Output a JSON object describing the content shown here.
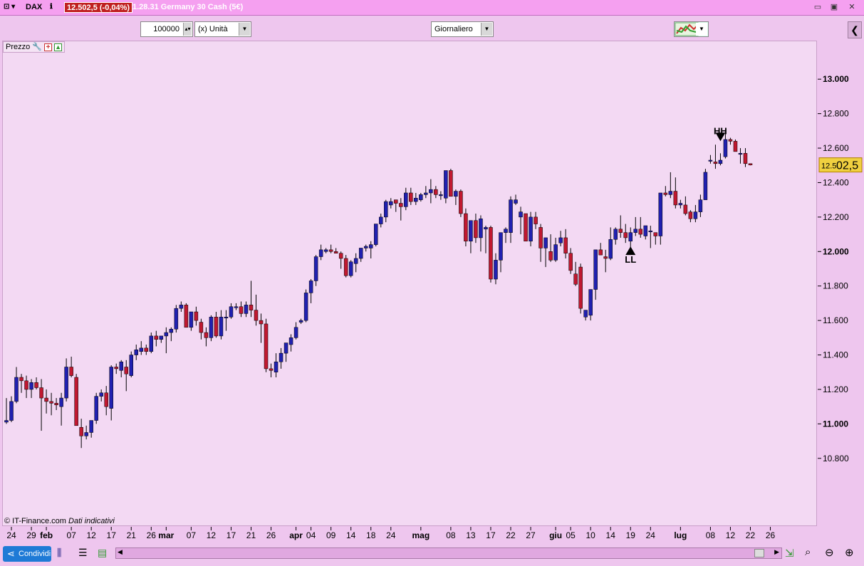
{
  "titlebar": {
    "symbol": "DAX",
    "price_badge": "12.502,5 (-0,04%)",
    "instrument": "1.28.31 Germany 30 Cash (5€)"
  },
  "toolbar": {
    "quantity": "100000",
    "unit": "(x) Unità",
    "timeframe": "Giornaliero"
  },
  "panel_label": "Prezzo",
  "footer": {
    "copyright": "© IT-Finance.com",
    "disclaimer": "Dati indicativi",
    "share_label": "Condividi"
  },
  "current_price_label": {
    "small": "12.5",
    "large": "02,5",
    "value": 12502.5
  },
  "colors": {
    "bull": "#2020b0",
    "bear": "#c01830",
    "background": "#f3d9f3",
    "current_price_bg": "#f0d040"
  },
  "chart_data": {
    "type": "candlestick",
    "title": "",
    "ylim": [
      10700,
      13100
    ],
    "y_ticks": [
      {
        "value": 13000,
        "label": "13.000",
        "bold": true
      },
      {
        "value": 12800,
        "label": "12.800",
        "bold": false
      },
      {
        "value": 12600,
        "label": "12.600",
        "bold": false
      },
      {
        "value": 12400,
        "label": "12.400",
        "bold": false
      },
      {
        "value": 12200,
        "label": "12.200",
        "bold": false
      },
      {
        "value": 12000,
        "label": "12.000",
        "bold": true
      },
      {
        "value": 11800,
        "label": "11.800",
        "bold": false
      },
      {
        "value": 11600,
        "label": "11.600",
        "bold": false
      },
      {
        "value": 11400,
        "label": "11.400",
        "bold": false
      },
      {
        "value": 11200,
        "label": "11.200",
        "bold": false
      },
      {
        "value": 11000,
        "label": "11.000",
        "bold": true
      },
      {
        "value": 10800,
        "label": "10.800",
        "bold": false
      }
    ],
    "x_ticks": [
      {
        "index": 1,
        "label": "24",
        "bold": false
      },
      {
        "index": 5,
        "label": "29",
        "bold": false
      },
      {
        "index": 8,
        "label": "feb",
        "bold": true
      },
      {
        "index": 13,
        "label": "07",
        "bold": false
      },
      {
        "index": 17,
        "label": "12",
        "bold": false
      },
      {
        "index": 21,
        "label": "17",
        "bold": false
      },
      {
        "index": 25,
        "label": "21",
        "bold": false
      },
      {
        "index": 29,
        "label": "26",
        "bold": false
      },
      {
        "index": 32,
        "label": "mar",
        "bold": true
      },
      {
        "index": 37,
        "label": "07",
        "bold": false
      },
      {
        "index": 41,
        "label": "12",
        "bold": false
      },
      {
        "index": 45,
        "label": "17",
        "bold": false
      },
      {
        "index": 49,
        "label": "21",
        "bold": false
      },
      {
        "index": 53,
        "label": "26",
        "bold": false
      },
      {
        "index": 58,
        "label": "apr",
        "bold": true
      },
      {
        "index": 61,
        "label": "04",
        "bold": false
      },
      {
        "index": 65,
        "label": "09",
        "bold": false
      },
      {
        "index": 69,
        "label": "14",
        "bold": false
      },
      {
        "index": 73,
        "label": "18",
        "bold": false
      },
      {
        "index": 77,
        "label": "24",
        "bold": false
      },
      {
        "index": 83,
        "label": "mag",
        "bold": true
      },
      {
        "index": 89,
        "label": "08",
        "bold": false
      },
      {
        "index": 93,
        "label": "13",
        "bold": false
      },
      {
        "index": 97,
        "label": "17",
        "bold": false
      },
      {
        "index": 101,
        "label": "22",
        "bold": false
      },
      {
        "index": 105,
        "label": "27",
        "bold": false
      },
      {
        "index": 110,
        "label": "giu",
        "bold": true
      },
      {
        "index": 113,
        "label": "05",
        "bold": false
      },
      {
        "index": 117,
        "label": "10",
        "bold": false
      },
      {
        "index": 121,
        "label": "14",
        "bold": false
      },
      {
        "index": 125,
        "label": "19",
        "bold": false
      },
      {
        "index": 129,
        "label": "24",
        "bold": false
      },
      {
        "index": 135,
        "label": "lug",
        "bold": true
      },
      {
        "index": 141,
        "label": "08",
        "bold": false
      },
      {
        "index": 145,
        "label": "12",
        "bold": false
      },
      {
        "index": 149,
        "label": "22",
        "bold": false
      },
      {
        "index": 153,
        "label": "26",
        "bold": false
      }
    ],
    "candles": [
      [
        11010,
        11150,
        11000,
        11020
      ],
      [
        11020,
        11160,
        11010,
        11130
      ],
      [
        11130,
        11330,
        11120,
        11270
      ],
      [
        11270,
        11290,
        11180,
        11250
      ],
      [
        11250,
        11280,
        11150,
        11200
      ],
      [
        11200,
        11260,
        11150,
        11240
      ],
      [
        11240,
        11270,
        11200,
        11210
      ],
      [
        11210,
        11260,
        10960,
        11150
      ],
      [
        11150,
        11200,
        11060,
        11130
      ],
      [
        11130,
        11180,
        11050,
        11120
      ],
      [
        11120,
        11150,
        11080,
        11110
      ],
      [
        11100,
        11180,
        10990,
        11150
      ],
      [
        11150,
        11380,
        11130,
        11330
      ],
      [
        11330,
        11390,
        11270,
        11280
      ],
      [
        11270,
        11290,
        11000,
        10990
      ],
      [
        10980,
        11030,
        10860,
        10930
      ],
      [
        10930,
        10990,
        10910,
        10950
      ],
      [
        10950,
        11020,
        10920,
        11020
      ],
      [
        11020,
        11180,
        11000,
        11160
      ],
      [
        11160,
        11200,
        11130,
        11180
      ],
      [
        11180,
        11220,
        11050,
        11100
      ],
      [
        11090,
        11340,
        11020,
        11330
      ],
      [
        11330,
        11350,
        11290,
        11320
      ],
      [
        11310,
        11370,
        11270,
        11360
      ],
      [
        11330,
        11370,
        11190,
        11290
      ],
      [
        11280,
        11420,
        11270,
        11400
      ],
      [
        11400,
        11460,
        11370,
        11430
      ],
      [
        11420,
        11480,
        11400,
        11440
      ],
      [
        11440,
        11460,
        11400,
        11420
      ],
      [
        11420,
        11530,
        11410,
        11510
      ],
      [
        11510,
        11540,
        11450,
        11490
      ],
      [
        11490,
        11510,
        11470,
        11510
      ],
      [
        11510,
        11560,
        11410,
        11530
      ],
      [
        11530,
        11560,
        11480,
        11550
      ],
      [
        11550,
        11690,
        11530,
        11670
      ],
      [
        11670,
        11710,
        11650,
        11690
      ],
      [
        11690,
        11700,
        11560,
        11560
      ],
      [
        11560,
        11650,
        11540,
        11650
      ],
      [
        11650,
        11680,
        11570,
        11600
      ],
      [
        11590,
        11610,
        11490,
        11530
      ],
      [
        11530,
        11560,
        11450,
        11500
      ],
      [
        11500,
        11630,
        11480,
        11620
      ],
      [
        11620,
        11650,
        11500,
        11510
      ],
      [
        11510,
        11660,
        11490,
        11620
      ],
      [
        11620,
        11660,
        11540,
        11620
      ],
      [
        11620,
        11700,
        11610,
        11680
      ],
      [
        11680,
        11700,
        11660,
        11680
      ],
      [
        11680,
        11710,
        11620,
        11640
      ],
      [
        11640,
        11710,
        11620,
        11690
      ],
      [
        11690,
        11830,
        11620,
        11660
      ],
      [
        11660,
        11750,
        11570,
        11600
      ],
      [
        11600,
        11640,
        11470,
        11580
      ],
      [
        11580,
        11610,
        11300,
        11320
      ],
      [
        11320,
        11350,
        11270,
        11310
      ],
      [
        11300,
        11410,
        11270,
        11360
      ],
      [
        11360,
        11440,
        11320,
        11410
      ],
      [
        11410,
        11470,
        11360,
        11470
      ],
      [
        11460,
        11520,
        11420,
        11500
      ],
      [
        11500,
        11590,
        11490,
        11560
      ],
      [
        11590,
        11610,
        11580,
        11600
      ],
      [
        11600,
        11780,
        11590,
        11760
      ],
      [
        11760,
        11840,
        11700,
        11830
      ],
      [
        11830,
        11980,
        11800,
        11970
      ],
      [
        11970,
        12040,
        11950,
        12010
      ],
      [
        12000,
        12020,
        11990,
        12010
      ],
      [
        12010,
        12040,
        11990,
        12000
      ],
      [
        12000,
        12020,
        11990,
        11990
      ],
      [
        11990,
        12000,
        11900,
        11960
      ],
      [
        11960,
        11980,
        11850,
        11860
      ],
      [
        11860,
        11950,
        11850,
        11940
      ],
      [
        11930,
        11990,
        11880,
        11960
      ],
      [
        11960,
        12020,
        11940,
        12020
      ],
      [
        12020,
        12040,
        12000,
        12030
      ],
      [
        12020,
        12060,
        11960,
        12040
      ],
      [
        12040,
        12140,
        12030,
        12160
      ],
      [
        12160,
        12220,
        12140,
        12200
      ],
      [
        12200,
        12300,
        12170,
        12290
      ],
      [
        12270,
        12310,
        12250,
        12290
      ],
      [
        12300,
        12300,
        12230,
        12280
      ],
      [
        12280,
        12310,
        12180,
        12260
      ],
      [
        12260,
        12370,
        12240,
        12340
      ],
      [
        12340,
        12370,
        12270,
        12290
      ],
      [
        12290,
        12340,
        12270,
        12310
      ],
      [
        12300,
        12340,
        12290,
        12330
      ],
      [
        12330,
        12380,
        12310,
        12340
      ],
      [
        12340,
        12420,
        12280,
        12360
      ],
      [
        12360,
        12380,
        12310,
        12330
      ],
      [
        12330,
        12350,
        12300,
        12330
      ],
      [
        12310,
        12380,
        12280,
        12470
      ],
      [
        12470,
        12480,
        12330,
        12320
      ],
      [
        12320,
        12360,
        12270,
        12350
      ],
      [
        12350,
        12360,
        12200,
        12220
      ],
      [
        12220,
        12250,
        12030,
        12060
      ],
      [
        12060,
        12170,
        11990,
        12180
      ],
      [
        12180,
        12220,
        12050,
        12080
      ],
      [
        12080,
        12210,
        12000,
        12190
      ],
      [
        12130,
        12150,
        11990,
        12140
      ],
      [
        12140,
        12150,
        11820,
        11840
      ],
      [
        11840,
        11990,
        11810,
        11950
      ],
      [
        11950,
        12110,
        11880,
        12110
      ],
      [
        12110,
        12140,
        12050,
        12130
      ],
      [
        12110,
        12320,
        12050,
        12300
      ],
      [
        12280,
        12330,
        12270,
        12300
      ],
      [
        12200,
        12260,
        12100,
        12230
      ],
      [
        12220,
        12220,
        12060,
        12060
      ],
      [
        12060,
        12230,
        12030,
        12200
      ],
      [
        12200,
        12230,
        12130,
        12160
      ],
      [
        12140,
        12160,
        11940,
        12020
      ],
      [
        12020,
        12080,
        11910,
        12080
      ],
      [
        12000,
        12100,
        11940,
        11950
      ],
      [
        11950,
        12080,
        11940,
        12040
      ],
      [
        12050,
        12120,
        12030,
        12080
      ],
      [
        12080,
        12130,
        11960,
        11990
      ],
      [
        11990,
        12020,
        11870,
        11890
      ],
      [
        11870,
        11940,
        11800,
        11810
      ],
      [
        11910,
        11930,
        11640,
        11670
      ],
      [
        11620,
        11640,
        11600,
        11660
      ],
      [
        11630,
        11770,
        11600,
        11780
      ],
      [
        11780,
        11800,
        11720,
        12010
      ],
      [
        12010,
        12050,
        11980,
        11980
      ],
      [
        11970,
        12010,
        11880,
        11960
      ],
      [
        11960,
        12140,
        11950,
        12070
      ],
      [
        12070,
        12140,
        12040,
        12130
      ],
      [
        12130,
        12210,
        12080,
        12110
      ],
      [
        12110,
        12160,
        12050,
        12080
      ],
      [
        12060,
        12140,
        11990,
        12110
      ],
      [
        12110,
        12200,
        12090,
        12130
      ],
      [
        12130,
        12200,
        12080,
        12100
      ],
      [
        12090,
        12140,
        12070,
        12150
      ],
      [
        12120,
        12150,
        12020,
        12120
      ],
      [
        12110,
        12100,
        12040,
        12090
      ],
      [
        12090,
        12100,
        12040,
        12340
      ],
      [
        12340,
        12380,
        12320,
        12330
      ],
      [
        12330,
        12460,
        12310,
        12350
      ],
      [
        12350,
        12430,
        12250,
        12270
      ],
      [
        12270,
        12300,
        12250,
        12280
      ],
      [
        12270,
        12320,
        12210,
        12220
      ],
      [
        12230,
        12240,
        12170,
        12190
      ],
      [
        12190,
        12270,
        12170,
        12230
      ],
      [
        12230,
        12330,
        12200,
        12300
      ],
      [
        12300,
        12480,
        12300,
        12460
      ],
      [
        12530,
        12560,
        12510,
        12530
      ],
      [
        12520,
        12620,
        12480,
        12510
      ],
      [
        12510,
        12570,
        12500,
        12530
      ],
      [
        12550,
        12710,
        12540,
        12650
      ],
      [
        12650,
        12660,
        12620,
        12640
      ],
      [
        12640,
        12650,
        12590,
        12580
      ],
      [
        12570,
        12600,
        12510,
        12570
      ],
      [
        12570,
        12600,
        12490,
        12510
      ],
      [
        12510,
        12510,
        12500,
        12502
      ]
    ],
    "annotations": [
      {
        "index": 143,
        "value": 12690,
        "label": "HH",
        "marker": "down"
      },
      {
        "index": 125,
        "value": 11980,
        "label": "LL",
        "marker": "up"
      }
    ]
  }
}
